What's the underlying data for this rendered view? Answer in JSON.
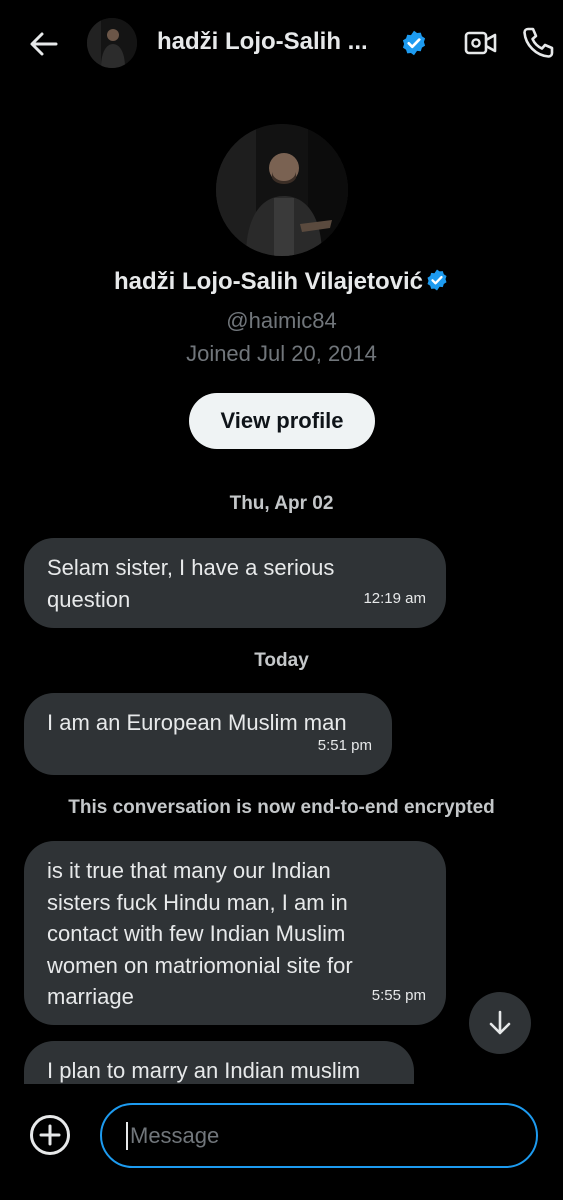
{
  "header": {
    "title": "hadži Lojo-Salih ...",
    "back_icon": "arrow-left-icon",
    "video_icon": "video-camera-icon",
    "phone_icon": "phone-icon",
    "verified_icon": "verified-badge-icon"
  },
  "profile": {
    "name": "hadži Lojo-Salih Vilajetović",
    "handle": "@haimic84",
    "joined": "Joined Jul 20, 2014",
    "view_profile_label": "View profile"
  },
  "conversation": {
    "separators": {
      "first": "Thu, Apr 02",
      "second": "Today",
      "encrypted": "This conversation is now end-to-end encrypted"
    },
    "messages": [
      {
        "text": "Selam sister, I have a serious question",
        "time": "12:19 am"
      },
      {
        "text": "I am an European Muslim man",
        "time": "5:51 pm"
      },
      {
        "text": "is it true that many our Indian sisters fuck Hindu man, I am in contact with few Indian Muslim women on matriomonial site for marriage",
        "time": "5:55 pm"
      },
      {
        "text": "I plan to marry an Indian muslim",
        "time": ""
      }
    ]
  },
  "composer": {
    "placeholder": "Message",
    "add_icon": "plus-circle-icon",
    "scroll_down_icon": "arrow-down-icon"
  },
  "colors": {
    "background": "#000000",
    "bubble": "#2f3336",
    "accent": "#1d9bf0",
    "muted_text": "#71767b"
  }
}
